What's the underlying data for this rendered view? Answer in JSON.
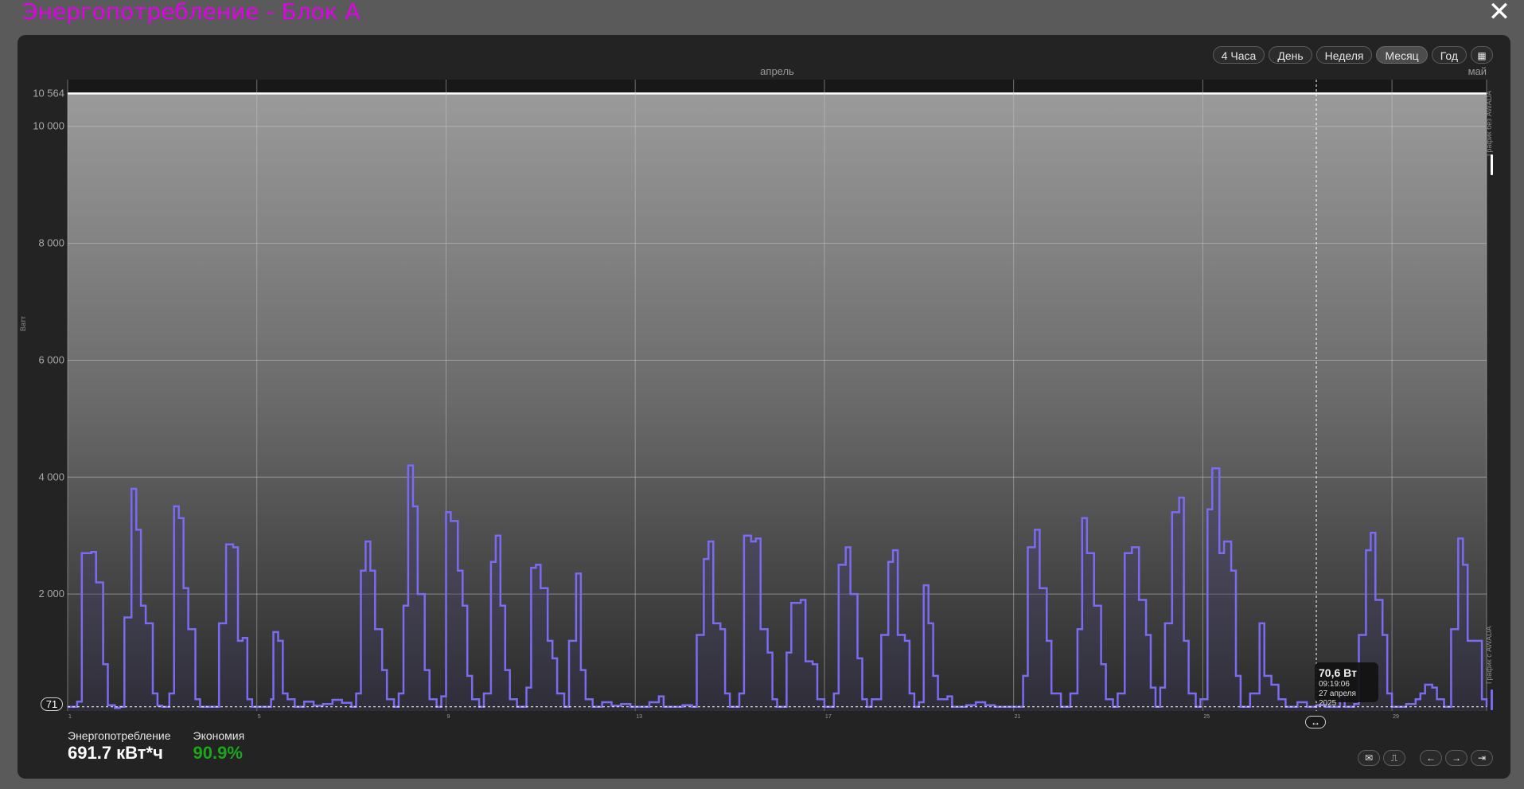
{
  "page": {
    "title": "Энергопотребление - Блок А",
    "close_icon": "close-icon"
  },
  "range_buttons": [
    {
      "label": "4 Часа",
      "active": false
    },
    {
      "label": "День",
      "active": false
    },
    {
      "label": "Неделя",
      "active": false
    },
    {
      "label": "Месяц",
      "active": true
    },
    {
      "label": "Год",
      "active": false
    }
  ],
  "calendar_icon": "calendar-icon",
  "stats": {
    "consumption_label": "Энергопотребление",
    "consumption_value": "691.7 кВт*ч",
    "economy_label": "Экономия",
    "economy_value": "90.9%"
  },
  "bottom_controls": [
    "mail-icon",
    "pulse-icon",
    "arrow-left-icon",
    "arrow-right-icon",
    "arrow-end-icon"
  ],
  "side_labels": {
    "top": "График без AWADA",
    "bottom": "График с AWADA"
  },
  "tooltip": {
    "value": "70,6 Вт",
    "time": "09:19:06",
    "date": "27 апреля 2025"
  },
  "baseline_badge": "71",
  "colors": {
    "line": "#7a6cf0",
    "title": "#e000e8",
    "economy": "#1ba61b",
    "max_line": "#ffffff"
  },
  "chart_data": {
    "type": "line",
    "ylabel": "Ватт",
    "ylim": [
      0,
      10800
    ],
    "yticks": [
      {
        "label": "2 000",
        "value": 2000
      },
      {
        "label": "4 000",
        "value": 4000
      },
      {
        "label": "6 000",
        "value": 6000
      },
      {
        "label": "8 000",
        "value": 8000
      },
      {
        "label": "10 000",
        "value": 10000
      },
      {
        "label": "10 564",
        "value": 10564
      }
    ],
    "max_line": 10564,
    "baseline": 71,
    "month_labels": [
      "апрель",
      "май"
    ],
    "x_ticks": [
      "1",
      "5",
      "9",
      "13",
      "17",
      "21",
      "25",
      "29"
    ],
    "x_range": [
      1,
      31
    ],
    "cursor_x": 27.4,
    "series": [
      {
        "points": [
          [
            1,
            71
          ],
          [
            1.2,
            160
          ],
          [
            1.3,
            2700
          ],
          [
            1.5,
            2720
          ],
          [
            1.6,
            2200
          ],
          [
            1.75,
            800
          ],
          [
            1.85,
            100
          ],
          [
            2.0,
            50
          ],
          [
            2.1,
            71
          ],
          [
            2.2,
            1600
          ],
          [
            2.35,
            3800
          ],
          [
            2.45,
            3100
          ],
          [
            2.55,
            1800
          ],
          [
            2.65,
            1500
          ],
          [
            2.8,
            300
          ],
          [
            2.9,
            90
          ],
          [
            3.0,
            71
          ],
          [
            3.15,
            300
          ],
          [
            3.25,
            3500
          ],
          [
            3.35,
            3300
          ],
          [
            3.45,
            2100
          ],
          [
            3.55,
            1400
          ],
          [
            3.7,
            200
          ],
          [
            3.8,
            71
          ],
          [
            4.2,
            1500
          ],
          [
            4.35,
            2850
          ],
          [
            4.5,
            2800
          ],
          [
            4.6,
            1200
          ],
          [
            4.7,
            1250
          ],
          [
            4.8,
            200
          ],
          [
            4.9,
            71
          ],
          [
            5.3,
            200
          ],
          [
            5.35,
            1350
          ],
          [
            5.45,
            1200
          ],
          [
            5.55,
            300
          ],
          [
            5.65,
            200
          ],
          [
            5.8,
            71
          ],
          [
            6.0,
            160
          ],
          [
            6.2,
            90
          ],
          [
            6.4,
            120
          ],
          [
            6.6,
            190
          ],
          [
            6.8,
            140
          ],
          [
            7.0,
            71
          ],
          [
            7.1,
            300
          ],
          [
            7.2,
            2400
          ],
          [
            7.3,
            2900
          ],
          [
            7.4,
            2400
          ],
          [
            7.5,
            1400
          ],
          [
            7.65,
            700
          ],
          [
            7.75,
            200
          ],
          [
            7.9,
            71
          ],
          [
            8.0,
            300
          ],
          [
            8.1,
            1800
          ],
          [
            8.2,
            4200
          ],
          [
            8.3,
            3500
          ],
          [
            8.4,
            2000
          ],
          [
            8.55,
            700
          ],
          [
            8.65,
            200
          ],
          [
            8.8,
            71
          ],
          [
            8.9,
            250
          ],
          [
            9.0,
            3400
          ],
          [
            9.1,
            3250
          ],
          [
            9.25,
            2400
          ],
          [
            9.35,
            1800
          ],
          [
            9.45,
            600
          ],
          [
            9.55,
            200
          ],
          [
            9.7,
            71
          ],
          [
            9.8,
            300
          ],
          [
            9.95,
            2550
          ],
          [
            10.05,
            3000
          ],
          [
            10.15,
            1800
          ],
          [
            10.25,
            700
          ],
          [
            10.35,
            200
          ],
          [
            10.5,
            71
          ],
          [
            10.7,
            400
          ],
          [
            10.8,
            2450
          ],
          [
            10.9,
            2500
          ],
          [
            11.0,
            2100
          ],
          [
            11.15,
            1200
          ],
          [
            11.25,
            900
          ],
          [
            11.35,
            300
          ],
          [
            11.5,
            71
          ],
          [
            11.6,
            1200
          ],
          [
            11.75,
            2350
          ],
          [
            11.85,
            700
          ],
          [
            11.95,
            200
          ],
          [
            12.1,
            71
          ],
          [
            12.3,
            150
          ],
          [
            12.5,
            90
          ],
          [
            12.7,
            120
          ],
          [
            12.9,
            71
          ],
          [
            13.3,
            150
          ],
          [
            13.5,
            250
          ],
          [
            13.6,
            71
          ],
          [
            14.0,
            100
          ],
          [
            14.2,
            71
          ],
          [
            14.3,
            1300
          ],
          [
            14.45,
            2600
          ],
          [
            14.55,
            2900
          ],
          [
            14.65,
            1500
          ],
          [
            14.8,
            1400
          ],
          [
            14.9,
            300
          ],
          [
            15.0,
            71
          ],
          [
            15.2,
            300
          ],
          [
            15.3,
            3000
          ],
          [
            15.45,
            2900
          ],
          [
            15.55,
            2950
          ],
          [
            15.65,
            1400
          ],
          [
            15.8,
            1000
          ],
          [
            15.9,
            200
          ],
          [
            16.0,
            71
          ],
          [
            16.2,
            1000
          ],
          [
            16.3,
            1850
          ],
          [
            16.5,
            1900
          ],
          [
            16.6,
            850
          ],
          [
            16.75,
            800
          ],
          [
            16.85,
            200
          ],
          [
            17.0,
            71
          ],
          [
            17.2,
            300
          ],
          [
            17.3,
            2500
          ],
          [
            17.45,
            2800
          ],
          [
            17.55,
            2000
          ],
          [
            17.7,
            900
          ],
          [
            17.8,
            200
          ],
          [
            17.9,
            71
          ],
          [
            18.0,
            200
          ],
          [
            18.2,
            1300
          ],
          [
            18.35,
            2550
          ],
          [
            18.45,
            2750
          ],
          [
            18.55,
            1300
          ],
          [
            18.7,
            1200
          ],
          [
            18.8,
            300
          ],
          [
            18.9,
            71
          ],
          [
            19.0,
            150
          ],
          [
            19.1,
            2150
          ],
          [
            19.2,
            1500
          ],
          [
            19.3,
            600
          ],
          [
            19.4,
            200
          ],
          [
            19.6,
            250
          ],
          [
            19.7,
            71
          ],
          [
            20.0,
            100
          ],
          [
            20.2,
            150
          ],
          [
            20.4,
            100
          ],
          [
            20.6,
            71
          ],
          [
            21.2,
            600
          ],
          [
            21.3,
            2800
          ],
          [
            21.45,
            3100
          ],
          [
            21.55,
            2100
          ],
          [
            21.7,
            1200
          ],
          [
            21.8,
            300
          ],
          [
            22.0,
            71
          ],
          [
            22.2,
            300
          ],
          [
            22.35,
            1400
          ],
          [
            22.45,
            3300
          ],
          [
            22.55,
            2700
          ],
          [
            22.7,
            1800
          ],
          [
            22.85,
            800
          ],
          [
            22.95,
            200
          ],
          [
            23.1,
            71
          ],
          [
            23.2,
            300
          ],
          [
            23.35,
            2700
          ],
          [
            23.5,
            2800
          ],
          [
            23.65,
            1900
          ],
          [
            23.8,
            1300
          ],
          [
            23.9,
            400
          ],
          [
            24.0,
            71
          ],
          [
            24.1,
            400
          ],
          [
            24.2,
            1500
          ],
          [
            24.35,
            3400
          ],
          [
            24.5,
            3650
          ],
          [
            24.6,
            1200
          ],
          [
            24.7,
            300
          ],
          [
            24.85,
            71
          ],
          [
            24.95,
            200
          ],
          [
            25.1,
            3450
          ],
          [
            25.2,
            4150
          ],
          [
            25.35,
            2700
          ],
          [
            25.45,
            2900
          ],
          [
            25.6,
            2400
          ],
          [
            25.7,
            600
          ],
          [
            25.8,
            71
          ],
          [
            26.0,
            300
          ],
          [
            26.2,
            1500
          ],
          [
            26.3,
            600
          ],
          [
            26.45,
            450
          ],
          [
            26.6,
            200
          ],
          [
            26.75,
            71
          ],
          [
            27.0,
            150
          ],
          [
            27.2,
            71
          ],
          [
            27.4,
            100
          ],
          [
            27.6,
            71
          ],
          [
            27.9,
            250
          ],
          [
            28.0,
            71
          ],
          [
            28.2,
            120
          ],
          [
            28.3,
            1300
          ],
          [
            28.45,
            2750
          ],
          [
            28.55,
            3050
          ],
          [
            28.65,
            1900
          ],
          [
            28.8,
            1300
          ],
          [
            28.9,
            300
          ],
          [
            29.0,
            71
          ],
          [
            29.3,
            120
          ],
          [
            29.5,
            200
          ],
          [
            29.6,
            300
          ],
          [
            29.7,
            450
          ],
          [
            29.85,
            400
          ],
          [
            29.95,
            200
          ],
          [
            30.1,
            71
          ],
          [
            30.25,
            1400
          ],
          [
            30.4,
            2950
          ],
          [
            30.5,
            2500
          ],
          [
            30.6,
            1200
          ],
          [
            30.8,
            1200
          ],
          [
            30.9,
            200
          ],
          [
            31.0,
            71
          ]
        ]
      }
    ]
  }
}
